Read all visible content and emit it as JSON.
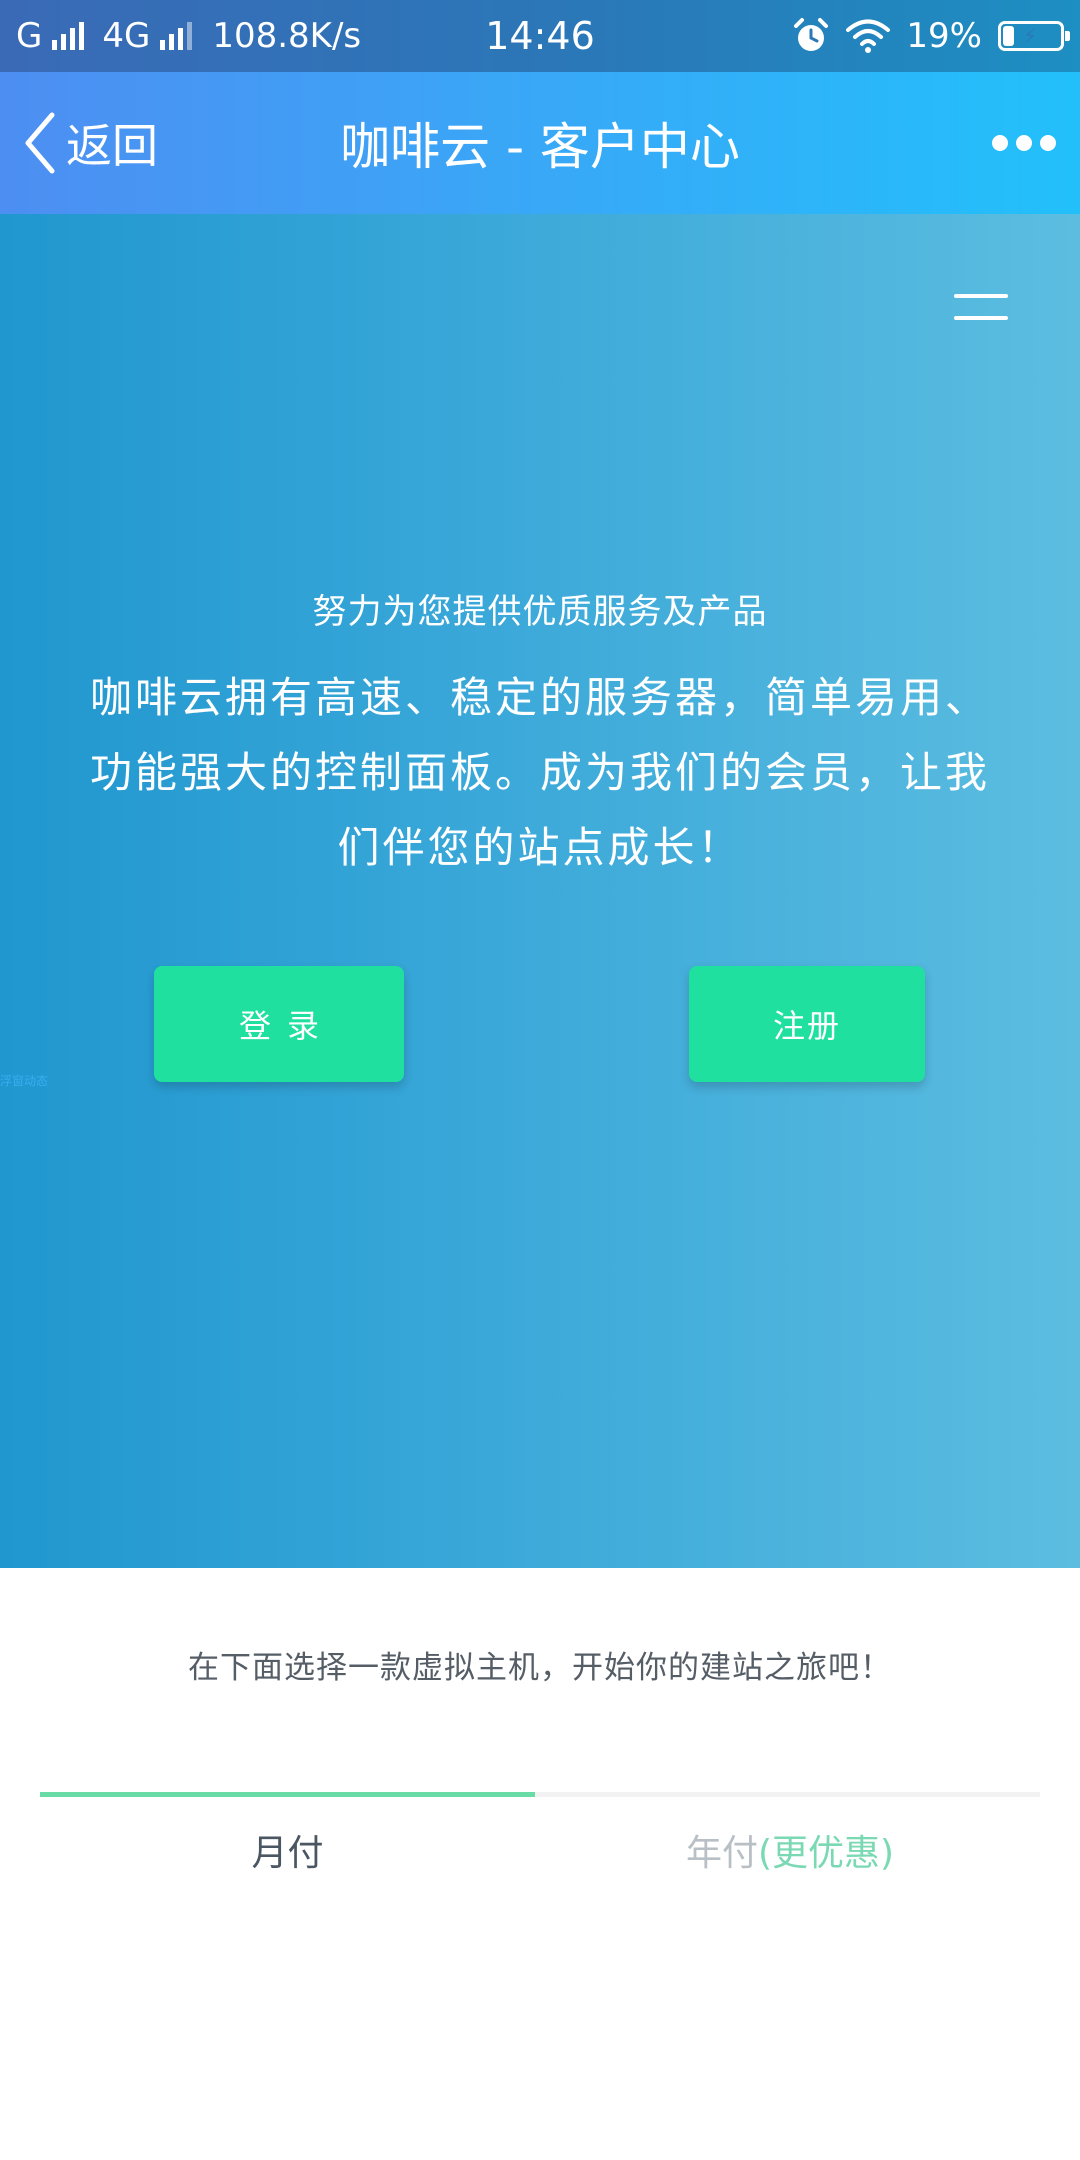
{
  "status_bar": {
    "carrier_1": "G",
    "carrier_2": "4G",
    "speed": "108.8K/s",
    "time": "14:46",
    "battery": "19%",
    "battery_level": 0.19
  },
  "nav": {
    "back_label": "返回",
    "title": "咖啡云 - 客户中心"
  },
  "hero": {
    "subtitle": "努力为您提供优质服务及产品",
    "description": "咖啡云拥有高速、稳定的服务器，简单易用、功能强大的控制面板。成为我们的会员，让我们伴您的站点成长！",
    "login_label": "登录",
    "register_label": "注册",
    "tiny_link": "浮窗动态"
  },
  "plans": {
    "prompt": "在下面选择一款虚拟主机，开始你的建站之旅吧！",
    "tab_monthly": "月付",
    "tab_yearly": "年付",
    "tab_yearly_accent": "(更优惠)",
    "active_tab": "月付"
  },
  "colors": {
    "nav_gradient_start": "#4d8ef2",
    "nav_gradient_end": "#22c0fb",
    "hero_start": "#2097cf",
    "hero_end": "#5cbde0",
    "button_green": "#1fe09f",
    "tab_indicator": "#68dba7"
  },
  "icons": {
    "back": "chevron-left-icon",
    "more": "more-dots-icon",
    "menu": "hamburger-menu-icon",
    "alarm": "alarm-clock-icon",
    "wifi": "wifi-icon",
    "battery": "battery-charging-icon"
  }
}
